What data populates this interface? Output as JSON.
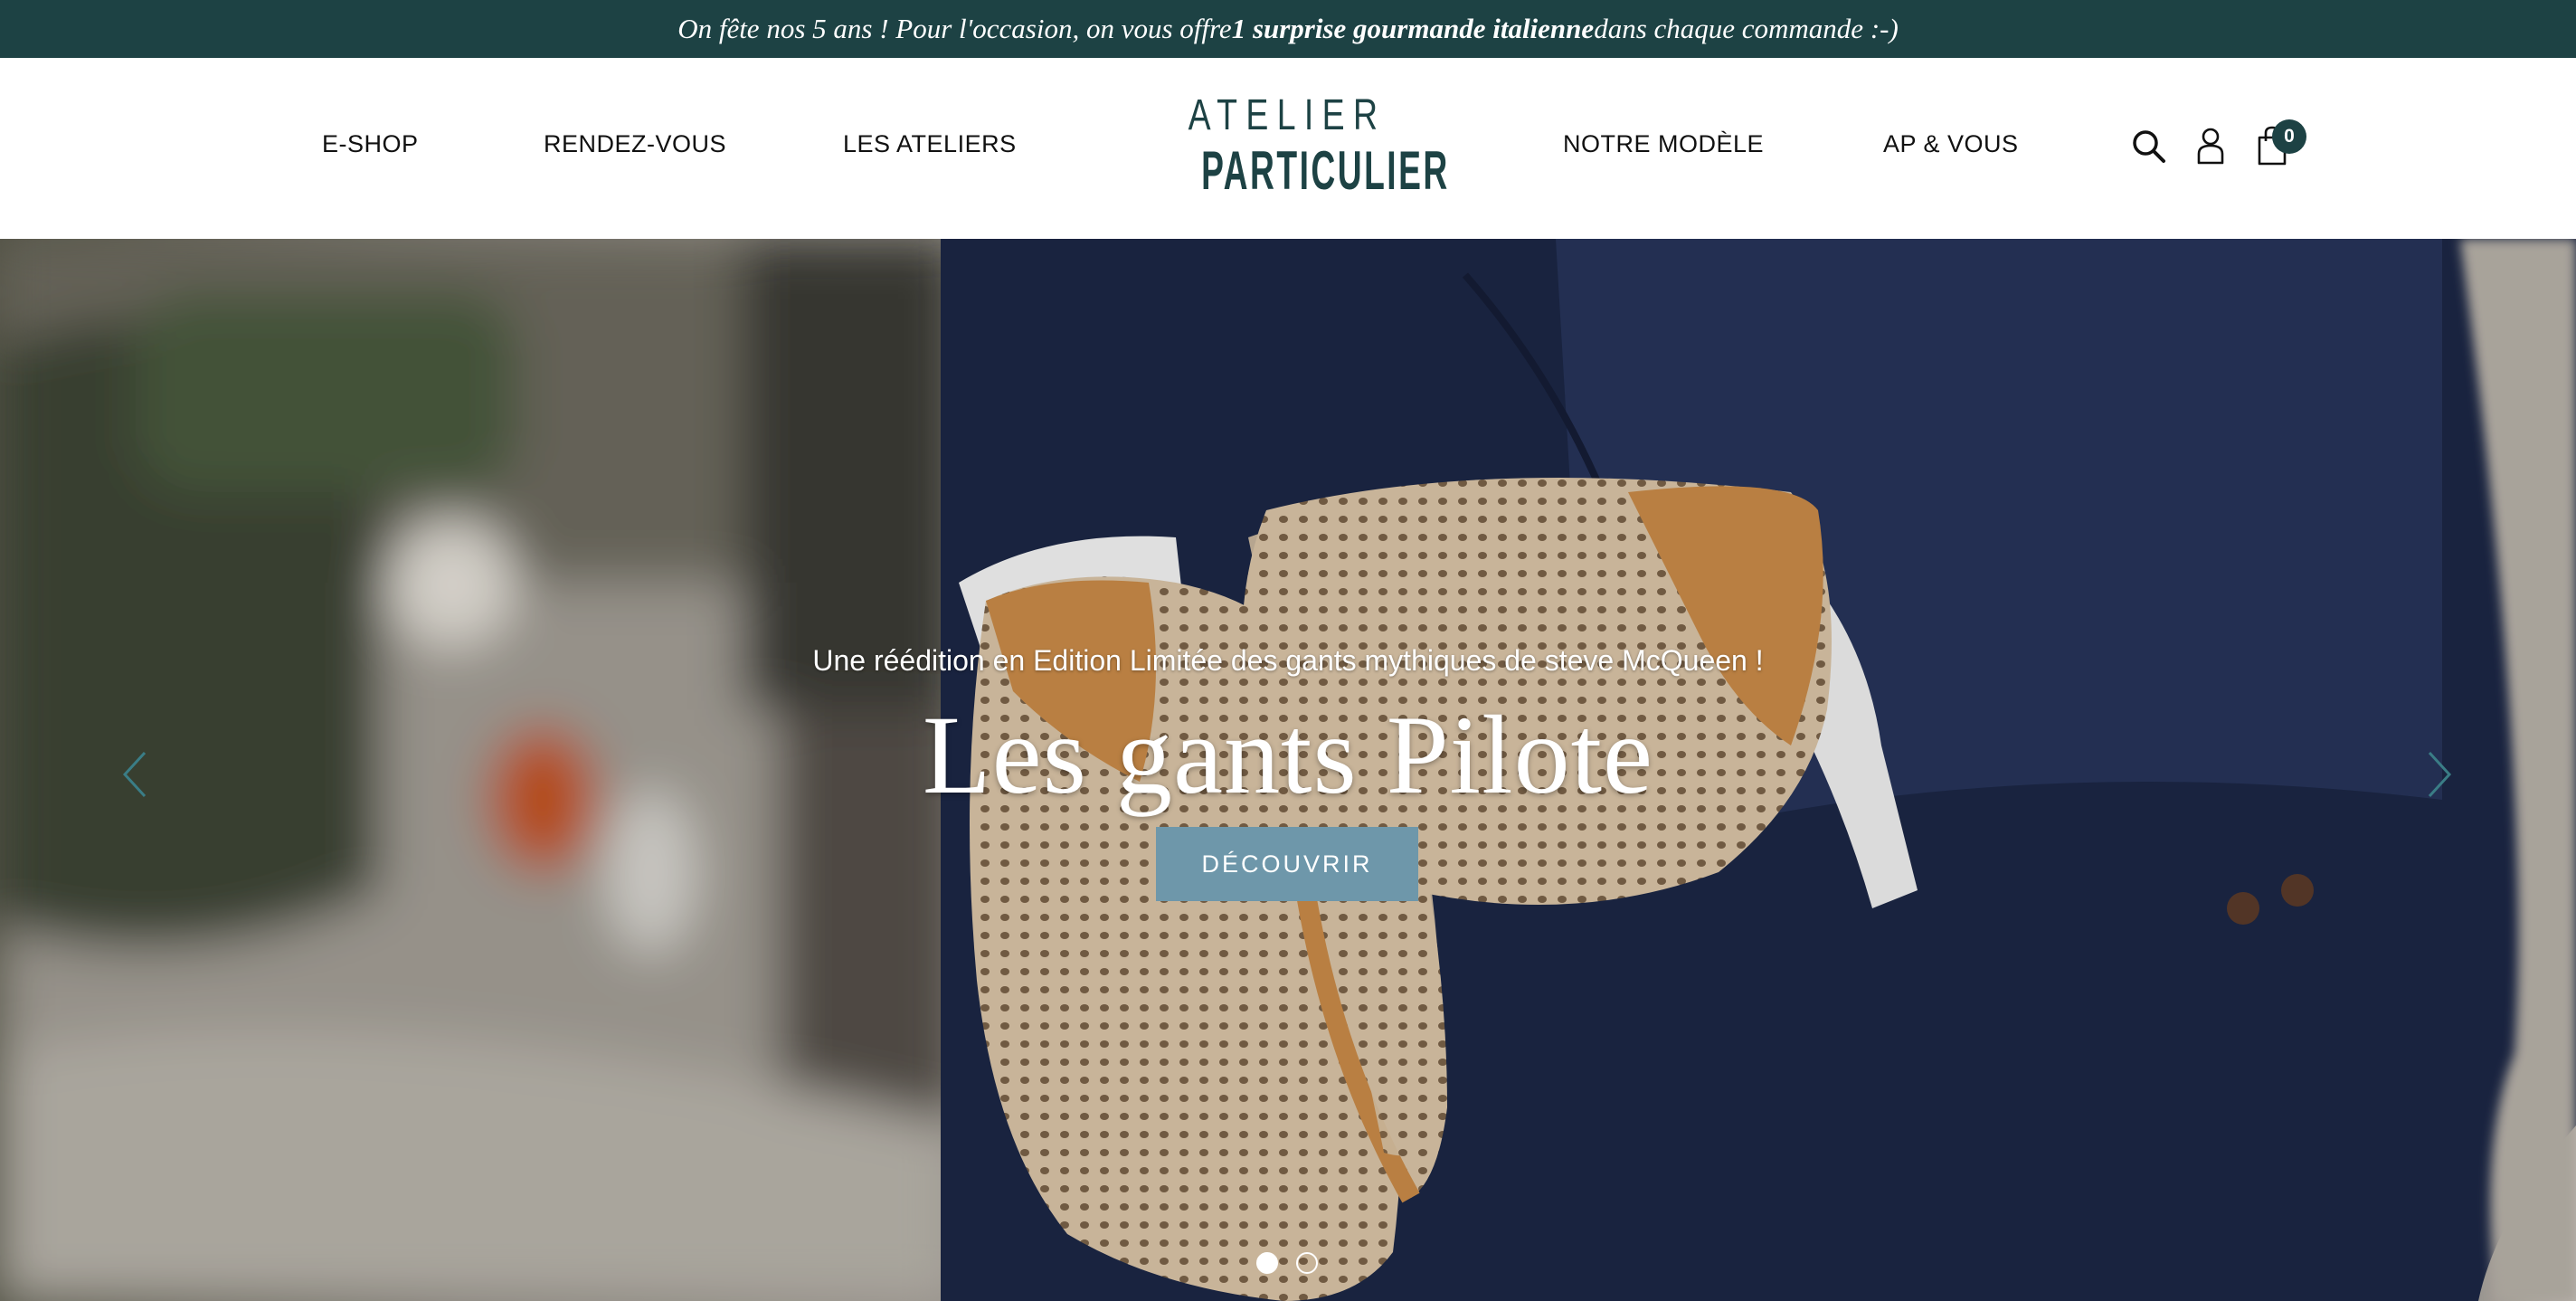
{
  "announcement": {
    "prefix": "On fête nos 5 ans ! Pour l'occasion, on vous offre ",
    "highlight": "1 surprise gourmande italienne",
    "suffix": " dans chaque commande :-)"
  },
  "nav": {
    "left": [
      "E-SHOP",
      "RENDEZ-VOUS",
      "LES ATELIERS"
    ],
    "right": [
      "NOTRE MODÈLE",
      "AP & VOUS"
    ]
  },
  "logo": {
    "line1": "ATELIER",
    "line2": "PARTICULIER"
  },
  "cart": {
    "count": "0"
  },
  "icons": {
    "search": "search-icon",
    "account": "user-icon",
    "cart": "shopping-bag-icon"
  },
  "hero": {
    "subtitle": "Une réédition en Edition Limitée des gants mythiques de steve McQueen !",
    "title": "Les gants Pilote",
    "cta": "DÉCOUVRIR",
    "slides_total": 2,
    "active_slide": 1
  },
  "colors": {
    "brand": "#1d4244",
    "cta": "#6e97aa",
    "arrows": "#3a7d86"
  }
}
